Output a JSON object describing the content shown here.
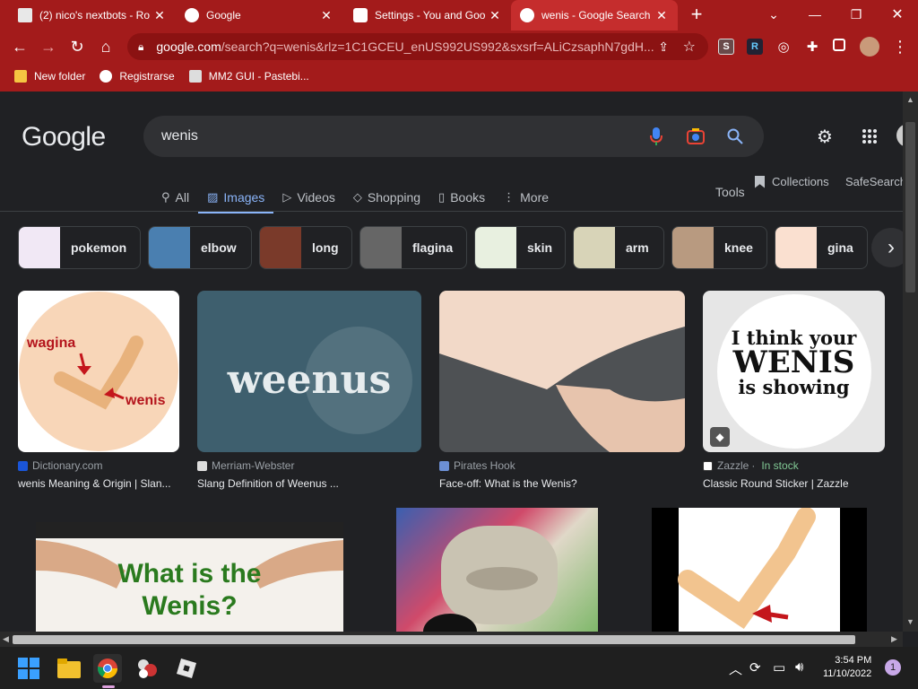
{
  "tabs": [
    {
      "title": "(2) nico's nextbots - Ro",
      "active": false
    },
    {
      "title": "Google",
      "active": false
    },
    {
      "title": "Settings - You and Goo",
      "active": false
    },
    {
      "title": "wenis - Google Search",
      "active": true
    }
  ],
  "new_tab_symbol": "+",
  "address": {
    "host": "google.com",
    "path": "/search?q=wenis&rlz=1C1GCEU_enUS992US992&sxsrf=ALiCzsaphN7gdH..."
  },
  "extensions": [
    "S",
    "R"
  ],
  "bookmarks": [
    "New folder",
    "Registrarse",
    "MM2 GUI - Pastebi..."
  ],
  "google": {
    "logo": "Google",
    "query": "wenis",
    "nav_tabs": [
      {
        "label": "All",
        "icon": "search-icon"
      },
      {
        "label": "Images",
        "icon": "image-icon",
        "selected": true
      },
      {
        "label": "Videos",
        "icon": "play-icon"
      },
      {
        "label": "Shopping",
        "icon": "tag-icon"
      },
      {
        "label": "Books",
        "icon": "book-icon"
      },
      {
        "label": "More",
        "icon": "more-vert-icon"
      }
    ],
    "tools": "Tools",
    "collections": "Collections",
    "safesearch": "SafeSearch",
    "chips": [
      "pokemon",
      "elbow",
      "long",
      "flagina",
      "skin",
      "arm",
      "knee",
      "gina"
    ],
    "results": [
      {
        "source": "Dictionary.com",
        "title": "wenis Meaning & Origin | Slan..."
      },
      {
        "source": "Merriam-Webster",
        "title": "Slang Definition of Weenus ..."
      },
      {
        "source": "Pirates Hook",
        "title": "Face-off: What is the Wenis?"
      },
      {
        "source": "Zazzle",
        "stock": "In stock",
        "title": "Classic Round Sticker | Zazzle"
      }
    ],
    "image_text": {
      "r1_wagina": "wagina",
      "r1_wenis": "wenis",
      "r2_weenus": "weenus",
      "r4_line1": "I think your",
      "r4_line2": "WENIS",
      "r4_line3": "is showing",
      "r5_line1": "What is the",
      "r5_line2": "Wenis?"
    }
  },
  "taskbar": {
    "time": "3:54 PM",
    "date": "11/10/2022",
    "notifications": "1"
  },
  "colors": {
    "chrome_frame": "#a31b1b",
    "page_bg": "#202124",
    "link_blue": "#8ab4f8"
  }
}
